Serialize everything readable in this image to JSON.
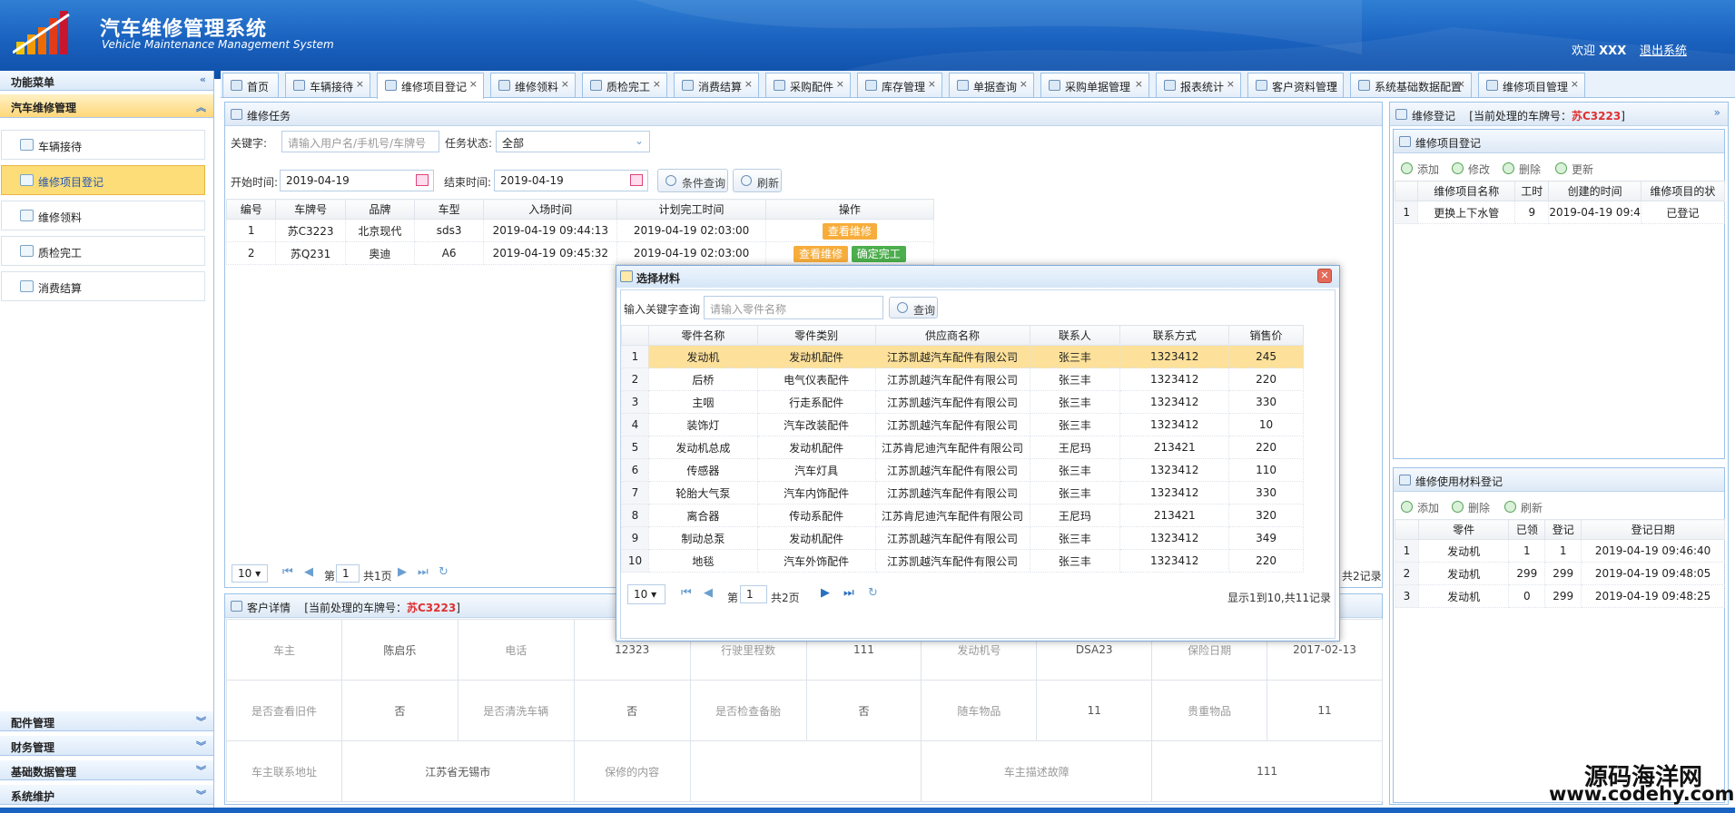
{
  "app": {
    "title_cn": "汽车维修管理系统",
    "title_en": "Vehicle Maintenance Management System",
    "welcome_prefix": "欢迎",
    "username": "XXX",
    "logout": "退出系统"
  },
  "sidebar": {
    "header": "功能菜单",
    "groups": [
      {
        "label": "汽车维修管理"
      },
      {
        "label": "配件管理"
      },
      {
        "label": "财务管理"
      },
      {
        "label": "基础数据管理"
      },
      {
        "label": "系统维护"
      }
    ],
    "items": [
      {
        "label": "车辆接待"
      },
      {
        "label": "维修项目登记"
      },
      {
        "label": "维修领料"
      },
      {
        "label": "质检完工"
      },
      {
        "label": "消费结算"
      }
    ]
  },
  "tabs": [
    {
      "label": "首页"
    },
    {
      "label": "车辆接待"
    },
    {
      "label": "维修项目登记"
    },
    {
      "label": "维修领料"
    },
    {
      "label": "质检完工"
    },
    {
      "label": "消费结算"
    },
    {
      "label": "采购配件"
    },
    {
      "label": "库存管理"
    },
    {
      "label": "单据查询"
    },
    {
      "label": "采购单据管理"
    },
    {
      "label": "报表统计"
    },
    {
      "label": "客户资料管理"
    },
    {
      "label": "系统基础数据配置"
    },
    {
      "label": "维修项目管理"
    }
  ],
  "task_panel": {
    "title": "维修任务",
    "keyword_label": "关键字:",
    "keyword_placeholder": "请输入用户名/手机号/车牌号",
    "status_label": "任务状态:",
    "status_value": "全部",
    "start_label": "开始时间:",
    "start_value": "2019-04-19",
    "end_label": "结束时间:",
    "end_value": "2019-04-19",
    "search_btn": "条件查询",
    "refresh_btn": "刷新",
    "columns": [
      "编号",
      "车牌号",
      "品牌",
      "车型",
      "入场时间",
      "计划完工时间",
      "操作"
    ],
    "rows": [
      {
        "no": "1",
        "plate": "苏C3223",
        "brand": "北京现代",
        "model": "sds3",
        "in_time": "2019-04-19 09:44:13",
        "plan_time": "2019-04-19 02:03:00",
        "actions": [
          "查看维修"
        ]
      },
      {
        "no": "2",
        "plate": "苏Q231",
        "brand": "奥迪",
        "model": "A6",
        "in_time": "2019-04-19 09:45:32",
        "plan_time": "2019-04-19 02:03:00",
        "actions": [
          "查看维修",
          "确定完工"
        ]
      }
    ],
    "pager": {
      "page_size": "10",
      "page_prefix": "第",
      "page": "1",
      "total_pages": "共1页",
      "record_suffix": "共2记录"
    }
  },
  "customer_panel": {
    "title": "客户详情",
    "current_prefix": "[当前处理的车牌号：",
    "current_plate": "苏C3223",
    "current_suffix": "]",
    "rows": [
      [
        "车主",
        "陈启乐",
        "电话",
        "12323",
        "行驶里程数",
        "111",
        "发动机号",
        "DSA23",
        "保险日期",
        "2017-02-13"
      ],
      [
        "是否查看旧件",
        "否",
        "是否清洗车辆",
        "否",
        "是否检查备胎",
        "否",
        "随车物品",
        "11",
        "贵重物品",
        "11"
      ],
      [
        "车主联系地址",
        "江苏省无锡市",
        "保修的内容",
        "",
        "车主描述故障",
        "111"
      ]
    ]
  },
  "repair_panel": {
    "title": "维修登记",
    "current_prefix": "[当前处理的车牌号：",
    "current_plate": "苏C3223",
    "current_suffix": "]",
    "item_title": "维修项目登记",
    "toolbar": [
      "添加",
      "修改",
      "删除",
      "更新"
    ],
    "columns": [
      "维修项目名称",
      "工时",
      "创建的时间",
      "维修项目的状"
    ],
    "rows": [
      [
        "1",
        "更换上下水管",
        "9",
        "2019-04-19 09:4",
        "已登记"
      ]
    ],
    "material_title": "维修使用材料登记",
    "material_toolbar": [
      "添加",
      "删除",
      "刷新"
    ],
    "material_columns": [
      "零件",
      "已领",
      "登记",
      "登记日期"
    ],
    "material_rows": [
      [
        "1",
        "发动机",
        "1",
        "1",
        "2019-04-19 09:46:40"
      ],
      [
        "2",
        "发动机",
        "299",
        "299",
        "2019-04-19 09:48:05"
      ],
      [
        "3",
        "发动机",
        "0",
        "299",
        "2019-04-19 09:48:25"
      ]
    ]
  },
  "dialog": {
    "title": "选择材料",
    "search_label": "输入关键字查询",
    "search_placeholder": "请输入零件名称",
    "search_btn": "查询",
    "columns": [
      "零件名称",
      "零件类别",
      "供应商名称",
      "联系人",
      "联系方式",
      "销售价"
    ],
    "rows": [
      [
        "1",
        "发动机",
        "发动机配件",
        "江苏凯越汽车配件有限公司",
        "张三丰",
        "1323412",
        "245"
      ],
      [
        "2",
        "后桥",
        "电气仪表配件",
        "江苏凯越汽车配件有限公司",
        "张三丰",
        "1323412",
        "220"
      ],
      [
        "3",
        "主咽",
        "行走系配件",
        "江苏凯越汽车配件有限公司",
        "张三丰",
        "1323412",
        "330"
      ],
      [
        "4",
        "装饰灯",
        "汽车改装配件",
        "江苏凯越汽车配件有限公司",
        "张三丰",
        "1323412",
        "10"
      ],
      [
        "5",
        "发动机总成",
        "发动机配件",
        "江苏肯尼迪汽车配件有限公司",
        "王尼玛",
        "213421",
        "220"
      ],
      [
        "6",
        "传感器",
        "汽车灯具",
        "江苏凯越汽车配件有限公司",
        "张三丰",
        "1323412",
        "110"
      ],
      [
        "7",
        "轮胎大气泵",
        "汽车内饰配件",
        "江苏凯越汽车配件有限公司",
        "张三丰",
        "1323412",
        "330"
      ],
      [
        "8",
        "离合器",
        "传动系配件",
        "江苏肯尼迪汽车配件有限公司",
        "王尼玛",
        "213421",
        "320"
      ],
      [
        "9",
        "制动总泵",
        "发动机配件",
        "江苏凯越汽车配件有限公司",
        "张三丰",
        "1323412",
        "349"
      ],
      [
        "10",
        "地毯",
        "汽车外饰配件",
        "江苏凯越汽车配件有限公司",
        "张三丰",
        "1323412",
        "220"
      ]
    ],
    "pager": {
      "page_size": "10",
      "page_prefix": "第",
      "page": "1",
      "total_pages": "共2页",
      "summary": "显示1到10,共11记录"
    }
  },
  "watermark": {
    "line1": "源码海洋网",
    "line2": "www.codehy.com"
  },
  "colors": {
    "header_blue": "#1a62bf",
    "active_yellow": "#fcdd77",
    "plate_red": "#e03030",
    "btn_orange": "#f7ad3b",
    "btn_green": "#4cae4c"
  }
}
